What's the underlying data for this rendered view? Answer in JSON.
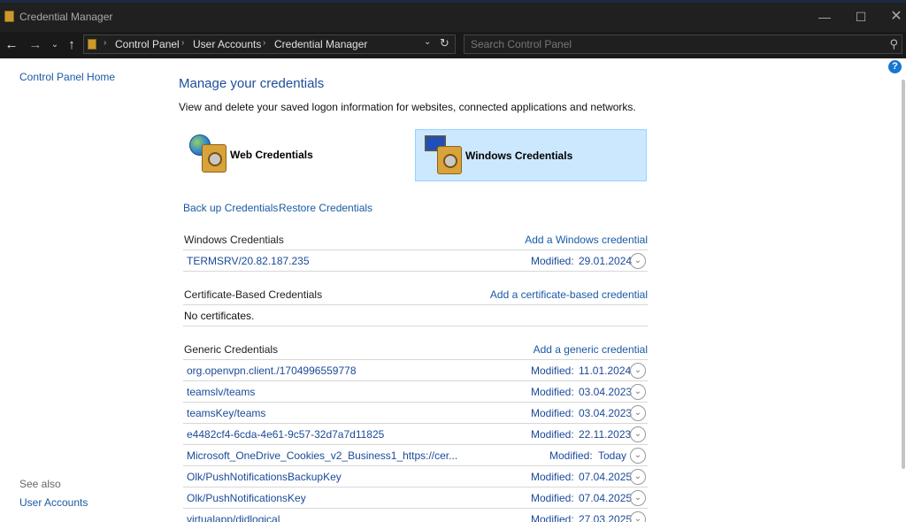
{
  "window": {
    "title": "Credential Manager",
    "minimize": "—",
    "maximize": "☐",
    "close": "✕"
  },
  "nav": {
    "back": "←",
    "forward": "→",
    "recent": "⌄",
    "up": "↑",
    "breadcrumb": [
      "Control Panel",
      "User Accounts",
      "Credential Manager"
    ],
    "dropdown": "⌄",
    "refresh": "↻",
    "search_placeholder": "Search Control Panel",
    "search_icon": "⚲"
  },
  "help": "?",
  "sidebar": {
    "home": "Control Panel Home",
    "see_also": "See also",
    "user_accounts": "User Accounts"
  },
  "main": {
    "title": "Manage your credentials",
    "description": "View and delete your saved logon information for websites, connected applications and networks.",
    "tiles": {
      "web": "Web Credentials",
      "windows": "Windows Credentials",
      "selected": "windows"
    },
    "backup": "Back up Credentials",
    "restore": "Restore Credentials"
  },
  "sections": {
    "windows": {
      "title": "Windows Credentials",
      "add": "Add a Windows credential"
    },
    "certificate": {
      "title": "Certificate-Based Credentials",
      "add": "Add a certificate-based credential",
      "empty": "No certificates."
    },
    "generic": {
      "title": "Generic Credentials",
      "add": "Add a generic credential"
    }
  },
  "modified_label": "Modified:",
  "windows_credentials": [
    {
      "name": "TERMSRV/20.82.187.235",
      "date": "29.01.2024"
    }
  ],
  "generic_credentials": [
    {
      "name": "org.openvpn.client./1704996559778",
      "date": "11.01.2024"
    },
    {
      "name": "teamslv/teams",
      "date": "03.04.2023"
    },
    {
      "name": "teamsKey/teams",
      "date": "03.04.2023"
    },
    {
      "name": "e4482cf4-6cda-4e61-9c57-32d7a7d11825",
      "date": "22.11.2023"
    },
    {
      "name": "Microsoft_OneDrive_Cookies_v2_Business1_https://cer...",
      "date": "Today"
    },
    {
      "name": "Olk/PushNotificationsBackupKey",
      "date": "07.04.2025"
    },
    {
      "name": "Olk/PushNotificationsKey",
      "date": "07.04.2025"
    },
    {
      "name": "virtualapp/didlogical",
      "date": "27.03.2025"
    }
  ]
}
